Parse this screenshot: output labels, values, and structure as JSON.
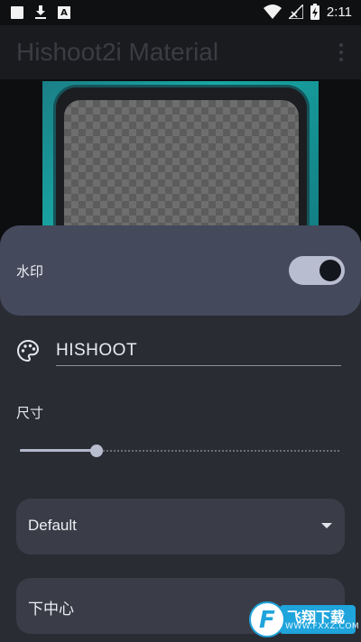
{
  "status_bar": {
    "time": "2:11",
    "icons": [
      "square-notification-icon",
      "download-icon",
      "text-notification-icon",
      "wifi-icon",
      "no-signal-icon",
      "battery-charging-icon"
    ],
    "text_icon_letter": "A"
  },
  "app_bar": {
    "title": "Hishoot2i Material",
    "menu_icon": "more-vertical-icon"
  },
  "preview": {
    "background_color": "#18a8a5",
    "screen_pattern": "checkerboard"
  },
  "watermark": {
    "label": "水印",
    "enabled": true,
    "accent": "#b9bdd0"
  },
  "text_field": {
    "icon": "palette-icon",
    "value": "HISHOOT"
  },
  "size": {
    "label": "尺寸",
    "value": 0.24
  },
  "font_select": {
    "value": "Default",
    "icon": "dropdown-arrow-icon"
  },
  "position_select": {
    "value": "下中心"
  },
  "site_logo": {
    "mark": "F",
    "name": "飞翔下载",
    "url": "WWW.FXXZ.COM"
  }
}
